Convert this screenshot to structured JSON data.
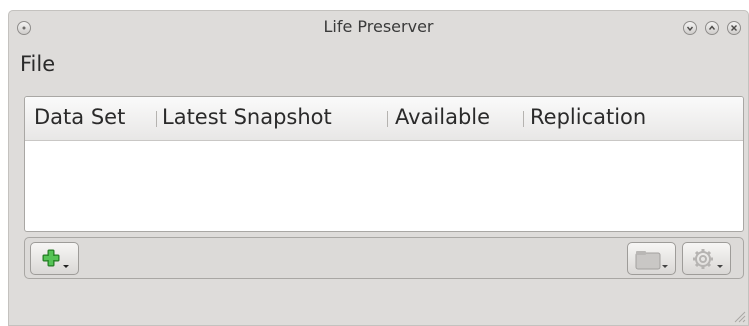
{
  "window": {
    "title": "Life Preserver"
  },
  "menubar": {
    "items": [
      {
        "label": "File"
      }
    ]
  },
  "table": {
    "columns": [
      {
        "label": "Data Set"
      },
      {
        "label": "Latest Snapshot"
      },
      {
        "label": "Available"
      },
      {
        "label": "Replication"
      }
    ],
    "rows": []
  },
  "toolbar": {
    "add_button_icon": "green-plus-icon",
    "folder_button_icon": "folder-icon",
    "settings_button_icon": "gear-icon"
  },
  "colors": {
    "window_bg": "#dedcda",
    "add_icon_green": "#3aa43a"
  }
}
